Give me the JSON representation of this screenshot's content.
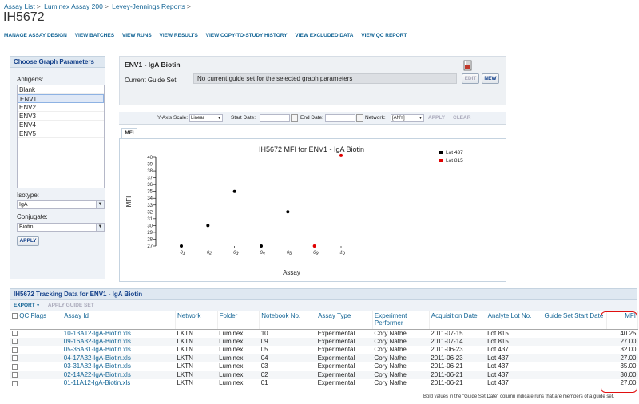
{
  "breadcrumb": [
    "Assay List",
    "Luminex Assay 200",
    "Levey-Jennings Reports"
  ],
  "page_title": "IH5672",
  "nav": [
    "MANAGE ASSAY DESIGN",
    "VIEW BATCHES",
    "VIEW RUNS",
    "VIEW RESULTS",
    "VIEW COPY-TO-STUDY HISTORY",
    "VIEW EXCLUDED DATA",
    "VIEW QC REPORT"
  ],
  "params": {
    "title": "Choose Graph Parameters",
    "antigens_label": "Antigens:",
    "antigens": [
      "Blank",
      "ENV1",
      "ENV2",
      "ENV3",
      "ENV4",
      "ENV5"
    ],
    "selected_antigen": "ENV1",
    "isotype_label": "Isotype:",
    "isotype": "IgA",
    "conjugate_label": "Conjugate:",
    "conjugate": "Biotin",
    "apply": "APPLY"
  },
  "guide": {
    "title": "ENV1 - IgA Biotin",
    "label": "Current Guide Set:",
    "value": "No current guide set for the selected graph parameters",
    "edit": "EDIT",
    "new": "NEW"
  },
  "toolbar": {
    "yscale_label": "Y-Axis Scale:",
    "yscale": "Linear",
    "start_label": "Start Date:",
    "end_label": "End Date:",
    "network_label": "Network:",
    "network": "[ANY]",
    "apply": "APPLY",
    "clear": "CLEAR"
  },
  "tab": "MFI",
  "chart_data": {
    "type": "scatter",
    "title": "IH5672 MFI for ENV1 - IgA Biotin",
    "xlabel": "Assay",
    "ylabel": "MFI",
    "categories": [
      "01",
      "02",
      "03",
      "04",
      "05",
      "09",
      "10"
    ],
    "ylim": [
      27,
      40
    ],
    "yticks": [
      27,
      28,
      29,
      30,
      31,
      32,
      33,
      34,
      35,
      36,
      37,
      38,
      39,
      40
    ],
    "series": [
      {
        "name": "Lot 437",
        "color": "#000000",
        "points": [
          [
            "01",
            27
          ],
          [
            "02",
            30
          ],
          [
            "03",
            35
          ],
          [
            "04",
            27
          ],
          [
            "05",
            32
          ]
        ]
      },
      {
        "name": "Lot 815",
        "color": "#e00000",
        "points": [
          [
            "09",
            27
          ],
          [
            "10",
            40.25
          ]
        ]
      }
    ],
    "legend": "top-right"
  },
  "grid": {
    "title": "IH5672 Tracking Data for ENV1 - IgA Biotin",
    "export": "EXPORT",
    "apply_guide": "APPLY GUIDE SET",
    "columns": [
      "QC Flags",
      "Assay Id",
      "Network",
      "Folder",
      "Notebook No.",
      "Assay Type",
      "Experiment Performer",
      "Acquisition Date",
      "Analyte Lot No.",
      "Guide Set Start Date",
      "MFI"
    ],
    "rows": [
      [
        "",
        "10-13A12-IgA-Biotin.xls",
        "LKTN",
        "Luminex",
        "10",
        "Experimental",
        "Cory Nathe",
        "2011-07-15",
        "Lot 815",
        "",
        "40.25"
      ],
      [
        "",
        "09-16A32-IgA-Biotin.xls",
        "LKTN",
        "Luminex",
        "09",
        "Experimental",
        "Cory Nathe",
        "2011-07-14",
        "Lot 815",
        "",
        "27.00"
      ],
      [
        "",
        "05-36A31-IgA-Biotin.xls",
        "LKTN",
        "Luminex",
        "05",
        "Experimental",
        "Cory Nathe",
        "2011-06-23",
        "Lot 437",
        "",
        "32.00"
      ],
      [
        "",
        "04-17A32-IgA-Biotin.xls",
        "LKTN",
        "Luminex",
        "04",
        "Experimental",
        "Cory Nathe",
        "2011-06-23",
        "Lot 437",
        "",
        "27.00"
      ],
      [
        "",
        "03-31A82-IgA-Biotin.xls",
        "LKTN",
        "Luminex",
        "03",
        "Experimental",
        "Cory Nathe",
        "2011-06-21",
        "Lot 437",
        "",
        "35.00"
      ],
      [
        "",
        "02-14A22-IgA-Biotin.xls",
        "LKTN",
        "Luminex",
        "02",
        "Experimental",
        "Cory Nathe",
        "2011-06-21",
        "Lot 437",
        "",
        "30.00"
      ],
      [
        "",
        "01-11A12-IgA-Biotin.xls",
        "LKTN",
        "Luminex",
        "01",
        "Experimental",
        "Cory Nathe",
        "2011-06-21",
        "Lot 437",
        "",
        "27.00"
      ]
    ]
  },
  "footnote": "Bold values in the \"Guide Set Date\" column indicate runs that are members of a guide set."
}
